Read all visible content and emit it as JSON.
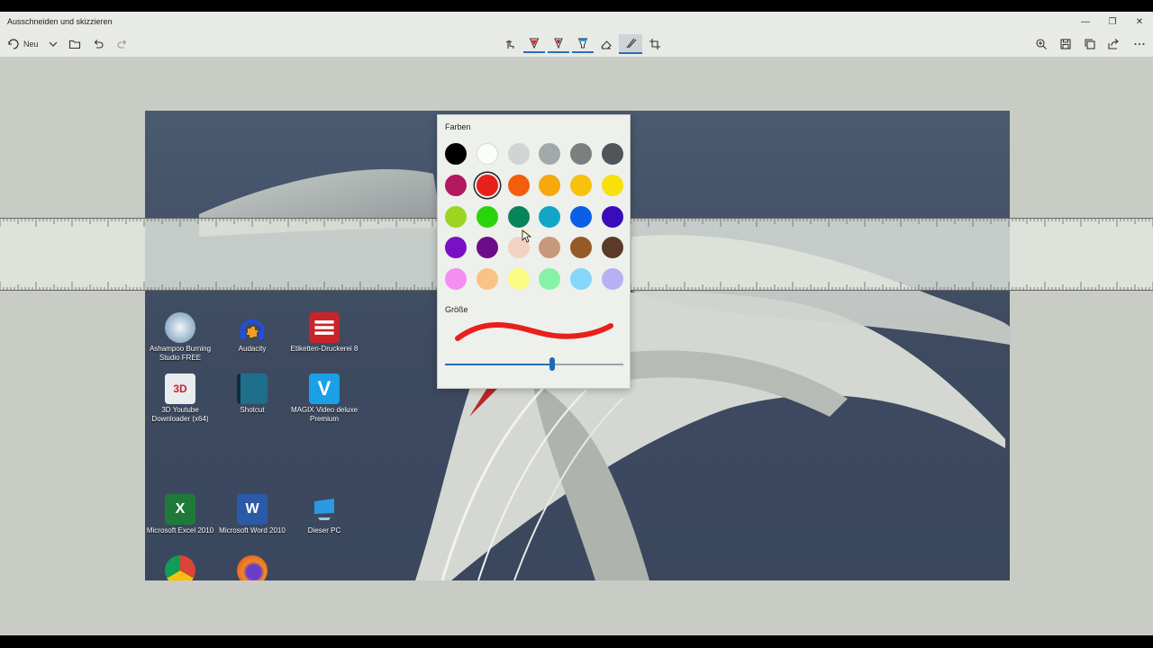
{
  "window": {
    "title": "Ausschneiden und skizzieren",
    "minimize_icon": "minimize-icon",
    "restore_icon": "restore-icon",
    "close_icon": "close-icon"
  },
  "toolbar": {
    "new_label": "Neu",
    "tools": [
      "touch-writing",
      "ballpoint-pen",
      "pencil",
      "highlighter",
      "eraser",
      "ruler",
      "crop"
    ],
    "active_tool": "ruler"
  },
  "flyout": {
    "colors_heading": "Farben",
    "size_heading": "Größe",
    "selected_color": "#e8201c",
    "size_fraction": 0.6,
    "colors": [
      [
        "#000000",
        "#fbfdf9",
        "#d1d4d2",
        "#a3a8aa",
        "#7a7f80",
        "#50555a"
      ],
      [
        "#b4185e",
        "#e8201c",
        "#f25e0c",
        "#f7a80e",
        "#f7c10c",
        "#f7e00c"
      ],
      [
        "#9bd520",
        "#2ad40c",
        "#08845a",
        "#12a5c8",
        "#0b5fe6",
        "#3a0cb9"
      ],
      [
        "#7a0fc8",
        "#6b0d8a",
        "#f2d3c2",
        "#c8987a",
        "#955a28",
        "#5c3a28"
      ],
      [
        "#f58ef0",
        "#f9c385",
        "#fbfc84",
        "#86f2a5",
        "#86d5fb",
        "#b8b0f5"
      ]
    ]
  },
  "desktop": {
    "icons": [
      {
        "label": "Ashampoo Burning Studio FREE",
        "color": "#d8e4ee"
      },
      {
        "label": "Audacity",
        "color": "#1f4fe0"
      },
      {
        "label": "Etiketten-Druckerei 8",
        "color": "#c8242a"
      },
      {
        "label": "3D Youtube Downloader (x64)",
        "color": "#e8ecef"
      },
      {
        "label": "Shotcut",
        "color": "#1d6f8c"
      },
      {
        "label": "MAGIX Video deluxe Premium",
        "color": "#1aa0e6"
      },
      {
        "label": "Microsoft Excel 2010",
        "color": "#1f7a3a"
      },
      {
        "label": "Microsoft Word 2010",
        "color": "#2a5aa8"
      },
      {
        "label": "Dieser PC",
        "color": "#2a7fc8"
      },
      {
        "label": "",
        "color": "#e04030"
      },
      {
        "label": "",
        "color": "#f08a20"
      }
    ]
  }
}
